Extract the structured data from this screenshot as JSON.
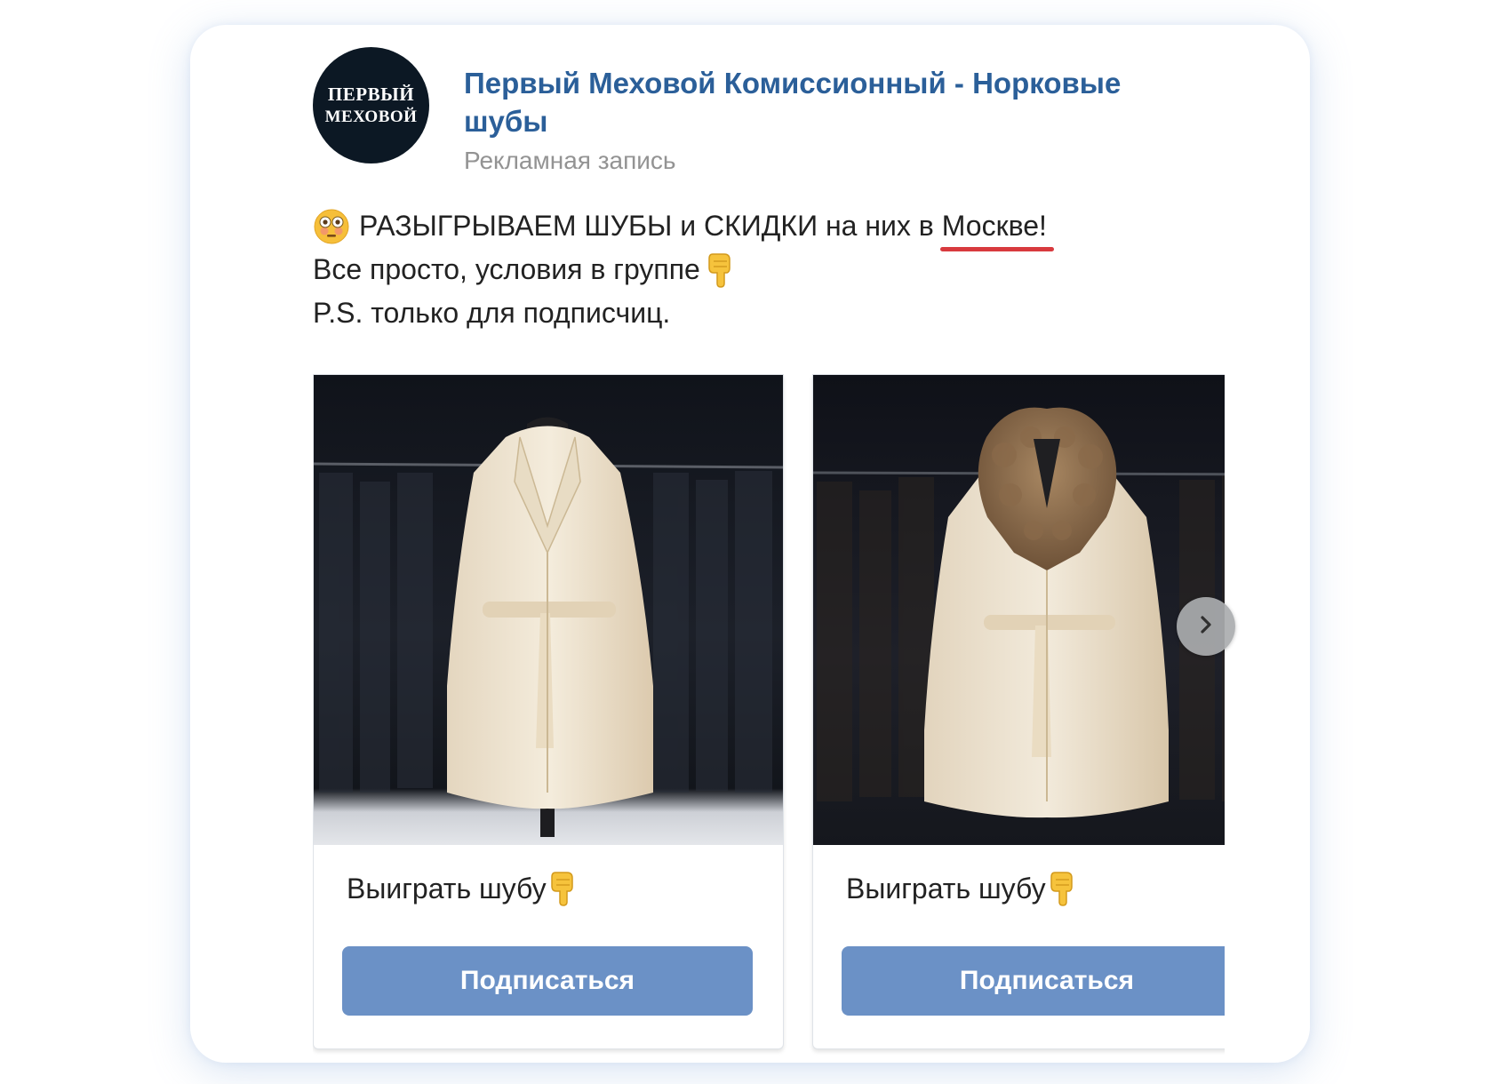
{
  "post": {
    "group_name": "Первый Меховой Комиссионный - Норковые шубы",
    "ad_label": "Рекламная запись",
    "avatar": {
      "line1": "ПЕРВЫЙ",
      "line2": "МЕХОВОЙ",
      "background": "#0c1824"
    },
    "text": {
      "line1_emoji": "flushed-face",
      "line1_main": "РАЗЫГРЫВАЕМ ШУБЫ и СКИДКИ на них в",
      "line1_city": "Москве!",
      "line2_main": "Все просто, условия в группе",
      "line2_emoji": "backhand-index-pointing-down",
      "line3": "P.S. только для подписчиц."
    },
    "highlight_color": "#d83a3e"
  },
  "carousel": {
    "cards": [
      {
        "photo": "white mink coat with belt on mannequin",
        "caption": "Выиграть шубу",
        "caption_emoji": "backhand-index-pointing-down",
        "button_label": "Подписаться"
      },
      {
        "photo": "white mink coat with sable fur collar on mannequin",
        "caption": "Выиграть шубу",
        "caption_emoji": "backhand-index-pointing-down",
        "button_label": "Подписаться"
      }
    ],
    "next_icon": "chevron-right-icon"
  },
  "colors": {
    "link": "#2b5f99",
    "secondary_text": "#939393",
    "button": "#6b91c6",
    "text": "#222222"
  }
}
